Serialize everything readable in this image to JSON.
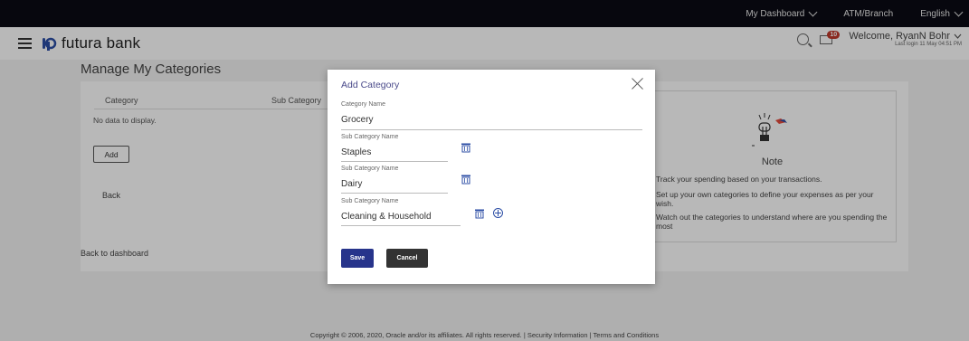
{
  "topbar": {
    "my_dashboard": "My Dashboard",
    "atm_branch": "ATM/Branch",
    "language": "English"
  },
  "header": {
    "brand": "futura bank",
    "notification_count": "10",
    "welcome": "Welcome, RyanN Bohr",
    "last_login": "Last login 11 May 04:51 PM"
  },
  "page": {
    "title": "Manage My Categories",
    "columns": [
      "Category",
      "Sub Category"
    ],
    "empty_text": "No data to display.",
    "add_label": "Add",
    "back_label": "Back",
    "back_to_dashboard": "Back to dashboard"
  },
  "note": {
    "title": "Note",
    "lines": [
      "Track your spending based on your transactions.",
      "Set up your own categories to define your expenses as per your wish.",
      "Watch out the categories to understand where are you spending the most"
    ]
  },
  "modal": {
    "title": "Add Category",
    "category_label": "Category Name",
    "category_value": "Grocery",
    "sub_categories": [
      {
        "label": "Sub Category Name",
        "value": "Staples"
      },
      {
        "label": "Sub Category Name",
        "value": "Dairy"
      },
      {
        "label": "Sub Category Name",
        "value": "Cleaning & Household"
      }
    ],
    "save_label": "Save",
    "cancel_label": "Cancel"
  },
  "footer": {
    "text": "Copyright © 2006, 2020, Oracle and/or its affiliates. All rights reserved. | Security Information | Terms and Conditions"
  },
  "colors": {
    "primary": "#27348b",
    "topbar": "#0b0b14",
    "badge": "#c0392b"
  }
}
